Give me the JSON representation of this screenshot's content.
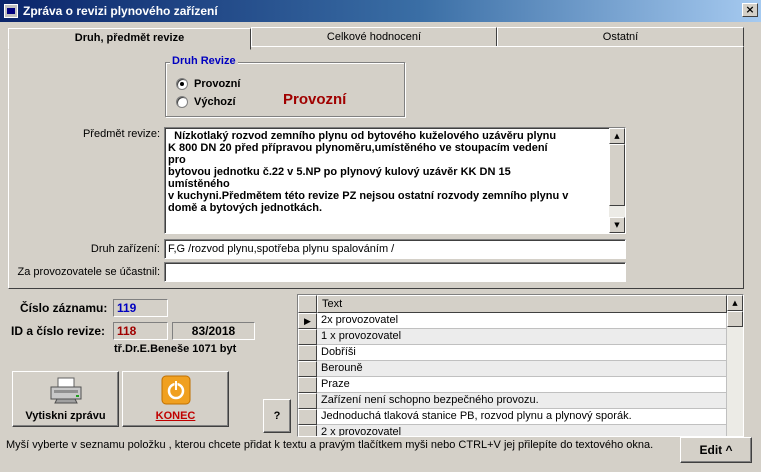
{
  "window": {
    "title": "Zpráva o revizi plynového zařízení",
    "close_label": "×"
  },
  "tabs": [
    {
      "label": "Druh, předmět revize"
    },
    {
      "label": "Celkové hodnocení"
    },
    {
      "label": "Ostatní"
    }
  ],
  "druh_revize": {
    "legend": "Druh Revize",
    "options": [
      {
        "label": "Provozní"
      },
      {
        "label": "Výchozí"
      }
    ],
    "selected_display": "Provozní"
  },
  "predmet": {
    "label": "Předmět revize:",
    "text": "  Nízkotlaký rozvod zemního plynu od bytového kuželového uzávěru plynu\nK 800 DN 20 před přípravou plynoměru,umístěného ve stoupacím vedení\npro\nbytovou jednotku č.22 v 5.NP po plynový kulový uzávěr KK DN 15\numístěného\nv kuchyni.Předmětem této revize PZ nejsou ostatní rozvody zemního plynu v\ndomě a bytových jednotkách."
  },
  "druh_zarizeni": {
    "label": "Druh zařízení:",
    "value": "F,G /rozvod plynu,spotřeba plynu spalováním /"
  },
  "ucastnil": {
    "label": "Za provozovatele se účastnil:",
    "value": ""
  },
  "info": {
    "cislo_label": "Číslo záznamu:",
    "cislo_value": "119",
    "id_label": "ID a číslo revize:",
    "id_value": "118",
    "revize_value": "83/2018",
    "address": "tř.Dr.E.Beneše 1071 byt"
  },
  "buttons": {
    "print_label": "Vytiskni zprávu",
    "end_label": "KONEC",
    "help_label": "?",
    "edit_label": "Edit ^"
  },
  "grid": {
    "header": "Text",
    "rows": [
      "2x provozovatel",
      "1 x provozovatel",
      "Dobříši",
      "Berouně",
      "Praze",
      "Zařízení není schopno  bezpečného provozu.",
      "Jednoduchá tlaková stanice PB, rozvod plynu a plynový sporák.",
      "2 x provozovatel"
    ]
  },
  "status_text": "Myší vyberte v seznamu položku , kterou chcete přidat k textu a pravým tlačítkem myši nebo CTRL+V jej přilepíte do textového okna.",
  "colors": {
    "blue_value": "#0000c0",
    "red_value": "#a00000",
    "title_bar": "#0a246a"
  }
}
